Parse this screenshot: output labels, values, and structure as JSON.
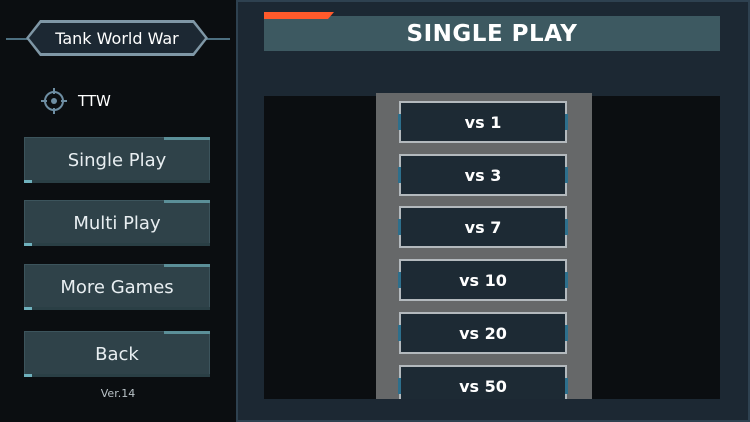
{
  "sidebar": {
    "game_title": "Tank World War",
    "player_name": "TTW",
    "menu": [
      {
        "label": "Single Play"
      },
      {
        "label": "Multi Play"
      },
      {
        "label": "More Games"
      },
      {
        "label": "Back"
      }
    ],
    "version": "Ver.14"
  },
  "main": {
    "title": "SINGLE PLAY",
    "options": [
      {
        "label": "vs 1"
      },
      {
        "label": "vs 3"
      },
      {
        "label": "vs 7"
      },
      {
        "label": "vs 10"
      },
      {
        "label": "vs 20"
      },
      {
        "label": "vs 50"
      }
    ]
  },
  "icons": {
    "player": "crosshair-icon"
  },
  "colors": {
    "accent": "#ff5a2b",
    "header_bar": "#3d5961",
    "button_bg": "#2f4249",
    "panel_bg": "#1c2833"
  }
}
